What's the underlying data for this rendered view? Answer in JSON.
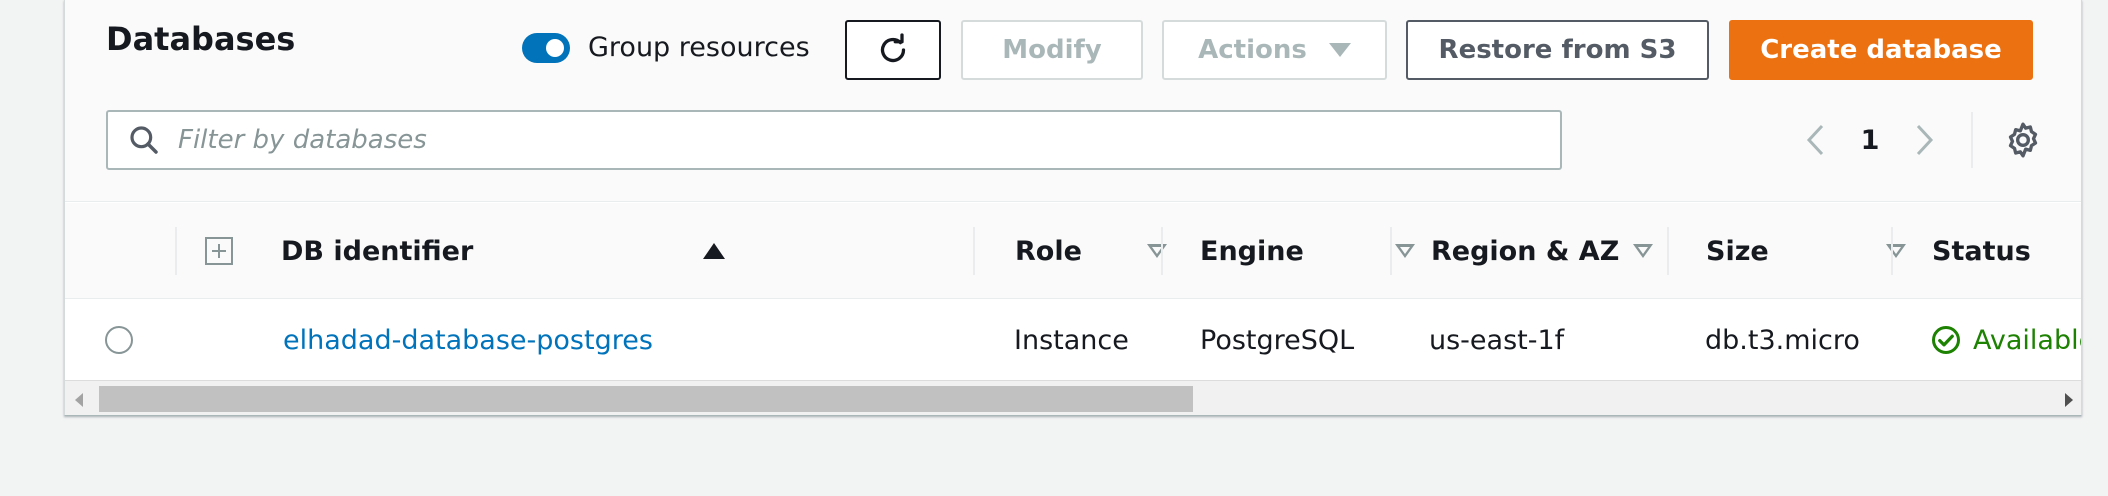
{
  "panel": {
    "title": "Databases"
  },
  "toolbar": {
    "group_label": "Group resources",
    "group_enabled": true,
    "modify_label": "Modify",
    "actions_label": "Actions",
    "restore_label": "Restore from S3",
    "create_label": "Create database"
  },
  "search": {
    "placeholder": "Filter by databases",
    "value": ""
  },
  "pagination": {
    "current_page": "1"
  },
  "table": {
    "columns": [
      {
        "label": "DB identifier",
        "sort": "ascending"
      },
      {
        "label": "Role",
        "sort": "none"
      },
      {
        "label": "Engine",
        "sort": "none"
      },
      {
        "label": "Region & AZ",
        "sort": "none"
      },
      {
        "label": "Size",
        "sort": "none"
      },
      {
        "label": "Status",
        "sort": "none"
      }
    ],
    "rows": [
      {
        "identifier": "elhadad-database-postgres",
        "role": "Instance",
        "engine": "PostgreSQL",
        "region": "us-east-1f",
        "size": "db.t3.micro",
        "status": "Available"
      }
    ]
  },
  "colors": {
    "primary": "#ec7211",
    "link": "#0073bb",
    "toggle": "#0073bb",
    "success": "#1d8102"
  },
  "icons": {
    "refresh": "refresh-icon",
    "search": "search-icon",
    "settings": "gear-icon",
    "status": "check-circle-icon",
    "expand": "expand-all-icon"
  }
}
